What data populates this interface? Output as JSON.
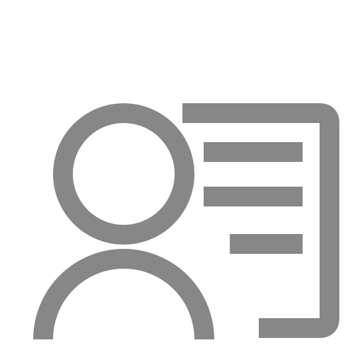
{
  "icon": {
    "name": "user-profile-card-icon",
    "color": "#878787",
    "background": "#ffffff"
  }
}
